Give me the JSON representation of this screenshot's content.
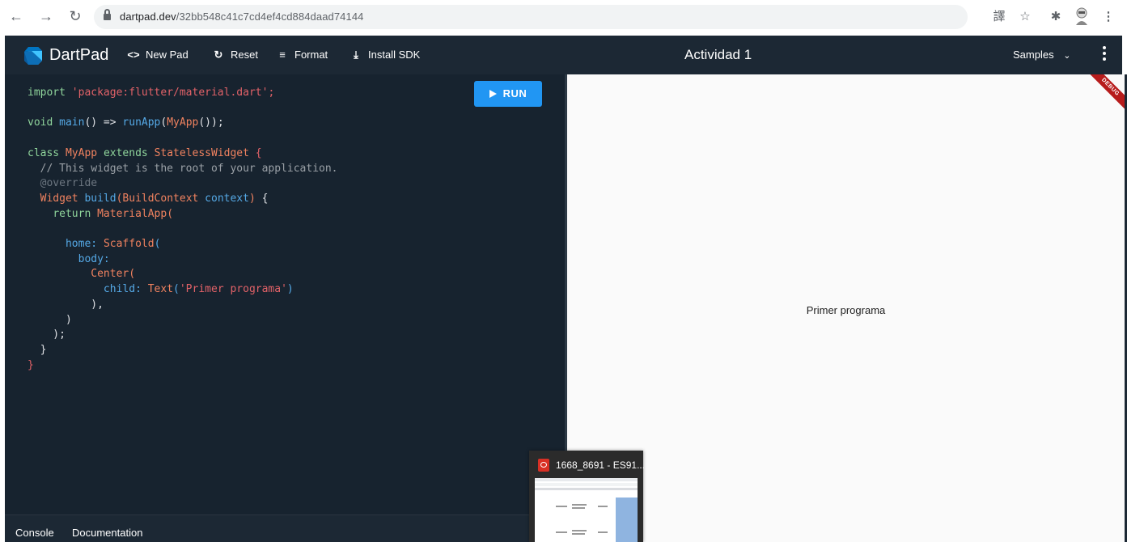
{
  "browser": {
    "url_host": "dartpad.dev",
    "url_path": "/32bb548c41c7cd4ef4cd884daad74144"
  },
  "app": {
    "brand": "DartPad",
    "toolbar": {
      "new_pad": "New Pad",
      "reset": "Reset",
      "format": "Format",
      "install_sdk": "Install SDK"
    },
    "title": "Actividad 1",
    "samples": "Samples"
  },
  "editor": {
    "run_label": "RUN",
    "code": [
      "import 'package:flutter/material.dart';",
      "",
      "void main() => runApp(MyApp());",
      "",
      "class MyApp extends StatelessWidget {",
      "  // This widget is the root of your application.",
      "  @override",
      "  Widget build(BuildContext context) {",
      "    return MaterialApp(",
      "",
      "      home: Scaffold(",
      "        body:",
      "          Center(",
      "            child: Text('Primer programa')",
      "          ),",
      "      )",
      "    );",
      "  }",
      "}"
    ]
  },
  "bottom_tabs": {
    "console": "Console",
    "documentation": "Documentation"
  },
  "output": {
    "text": "Primer programa",
    "debug_banner": "DEBUG"
  },
  "taskbar_preview": {
    "title": "1668_8691 - ES91..."
  },
  "colors": {
    "appbar": "#1c2834",
    "editor_bg": "#17232f",
    "run_button": "#2196f3",
    "debug_banner": "#b71c1c"
  }
}
